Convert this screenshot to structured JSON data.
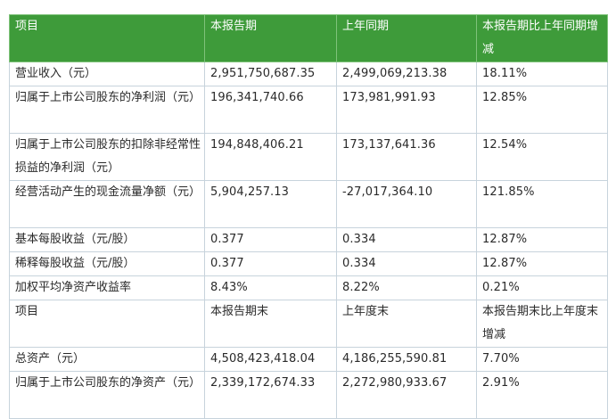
{
  "header": {
    "col1": "项目",
    "col2": "本报告期",
    "col3": "上年同期",
    "col4": "本报告期比上年同期增减"
  },
  "rows": [
    {
      "item": "营业收入（元）",
      "current": "2,951,750,687.35",
      "prior": "2,499,069,213.38",
      "change": "18.11%"
    },
    {
      "item": "归属于上市公司股东的净利润（元）",
      "current": "196,341,740.66",
      "prior": "173,981,991.93",
      "change": "12.85%"
    },
    {
      "item": "归属于上市公司股东的扣除非经常性损益的净利润（元）",
      "current": "194,848,406.21",
      "prior": "173,137,641.36",
      "change": "12.54%"
    },
    {
      "item": "经营活动产生的现金流量净额（元）",
      "current": "5,904,257.13",
      "prior": "-27,017,364.10",
      "change": "121.85%"
    },
    {
      "item": "基本每股收益（元/股）",
      "current": "0.377",
      "prior": "0.334",
      "change": "12.87%"
    },
    {
      "item": "稀释每股收益（元/股）",
      "current": "0.377",
      "prior": "0.334",
      "change": "12.87%"
    },
    {
      "item": "加权平均净资产收益率",
      "current": "8.43%",
      "prior": "8.22%",
      "change": "0.21%"
    }
  ],
  "subheader": {
    "col1": "项目",
    "col2": "本报告期末",
    "col3": "上年度末",
    "col4": "本报告期末比上年度末增减"
  },
  "rows2": [
    {
      "item": "总资产（元）",
      "current": "4,508,423,418.04",
      "prior": "4,186,255,590.81",
      "change": "7.70%"
    },
    {
      "item": "归属于上市公司股东的净资产（元）",
      "current": "2,339,172,674.33",
      "prior": "2,272,980,933.67",
      "change": "2.91%"
    }
  ]
}
